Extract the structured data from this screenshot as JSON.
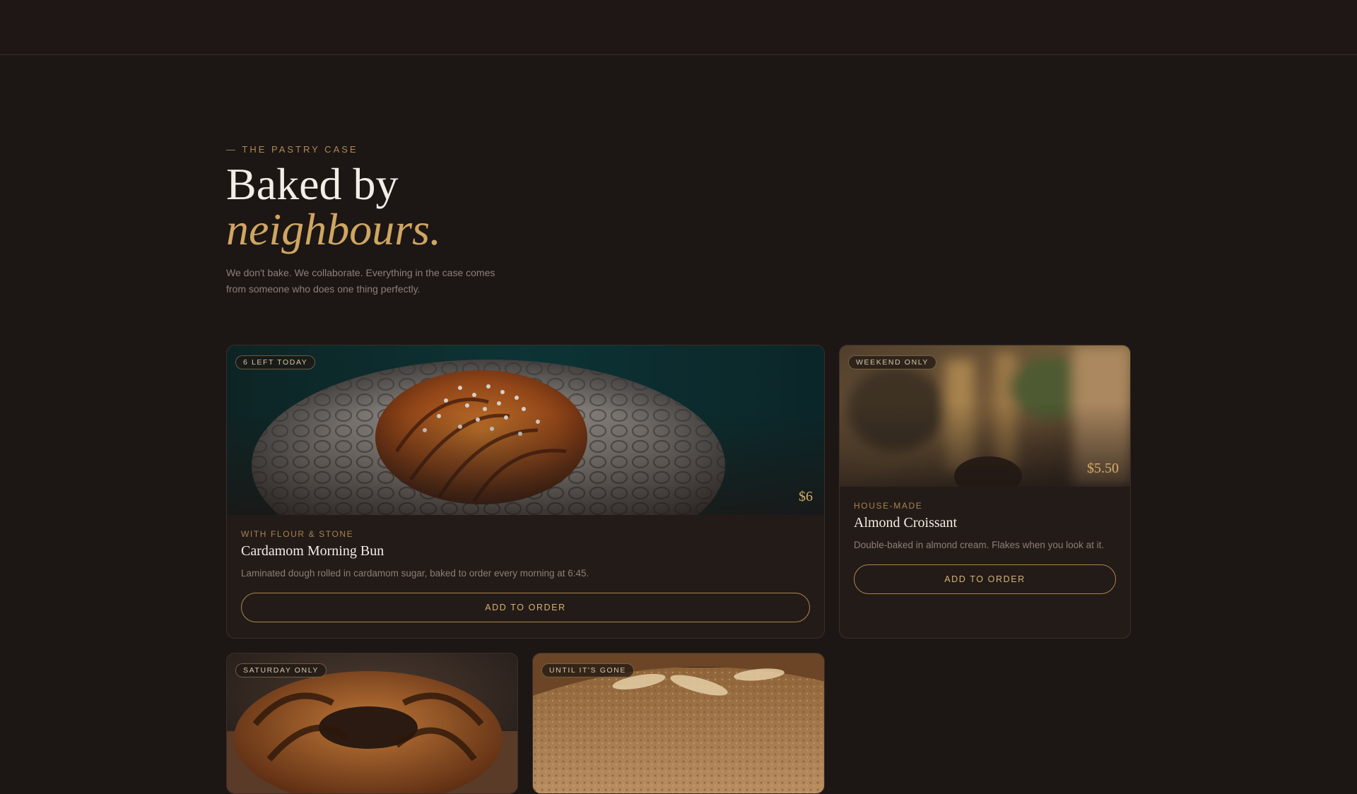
{
  "intro": {
    "eyebrow": "— THE PASTRY CASE",
    "headline_line1": "Baked by",
    "headline_line2": "neighbours.",
    "lede": "We don't bake. We collaborate. Everything in the case comes from someone who does one thing perfectly."
  },
  "cards": [
    {
      "badge": "6 LEFT TODAY",
      "price": "$6",
      "maker": "WITH FLOUR & STONE",
      "name": "Cardamom Morning Bun",
      "description": "Laminated dough rolled in cardamom sugar, baked to order every morning at 6:45.",
      "cta": "ADD TO ORDER"
    },
    {
      "badge": "WEEKEND ONLY",
      "price": "$5.50",
      "maker": "HOUSE-MADE",
      "name": "Almond Croissant",
      "description": "Double-baked in almond cream. Flakes when you look at it.",
      "cta": "ADD TO ORDER"
    },
    {
      "badge": "SATURDAY ONLY"
    },
    {
      "badge": "UNTIL IT'S GONE"
    }
  ],
  "colors": {
    "background": "#1c1614",
    "accent": "#cfa562",
    "card": "#231b18"
  }
}
